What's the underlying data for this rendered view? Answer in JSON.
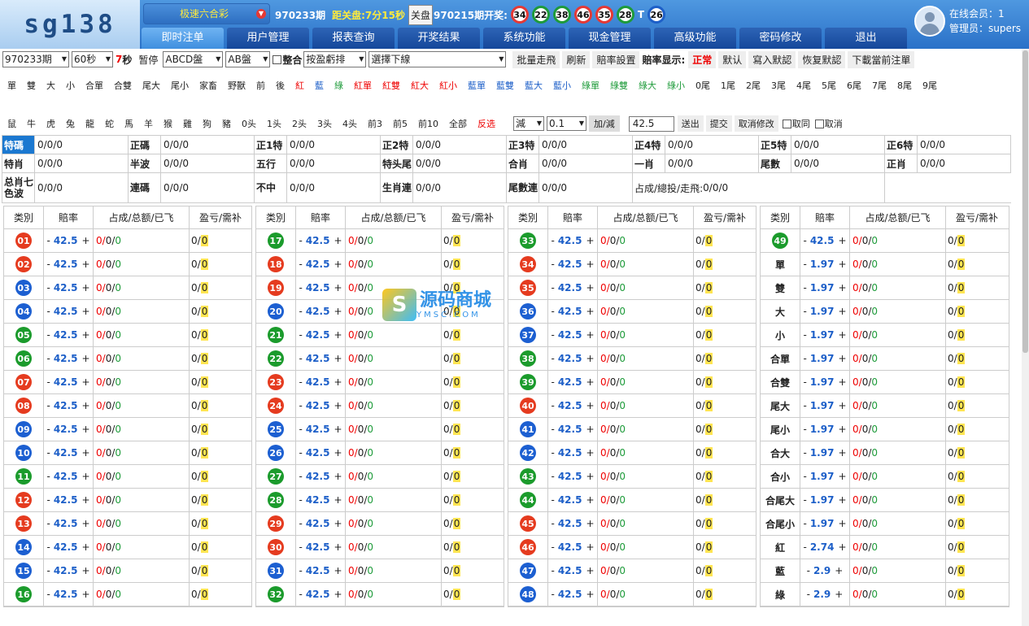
{
  "header": {
    "logo": "sg138",
    "lottery": "极速六合彩",
    "current_period": "970233期",
    "close_label": "距关盘:",
    "countdown": "7分15秒",
    "close_button": "关盘",
    "last_period": "970215期开奖:",
    "balls": [
      {
        "n": "34",
        "c": "red"
      },
      {
        "n": "22",
        "c": "green"
      },
      {
        "n": "38",
        "c": "green"
      },
      {
        "n": "46",
        "c": "red"
      },
      {
        "n": "35",
        "c": "red"
      },
      {
        "n": "28",
        "c": "green"
      },
      {
        "n": "26",
        "c": "blue"
      }
    ],
    "special_marker": "T",
    "online_label": "在线会员：",
    "online_count": "1",
    "admin_label": "管理员：",
    "admin_name": "supers"
  },
  "nav": [
    "即时注单",
    "用户管理",
    "报表查询",
    "开奖结果",
    "系统功能",
    "现金管理",
    "高级功能",
    "密码修改",
    "退出"
  ],
  "toolbar": {
    "period_select": "970233期",
    "interval_select": "60秒",
    "countdown": "7",
    "sec": "秒",
    "pause": "暂停",
    "pan_select": "ABCD盤",
    "ab_select": "AB盤",
    "merge": "整合",
    "sort_select": "按盈虧排",
    "line_select": "選擇下線",
    "batch": "批量走飛",
    "refresh": "刷新",
    "odds_set": "賠率設置",
    "odds_display_label": "賠率显示:",
    "odds_display_value": "正常",
    "default": "默认",
    "write_default": "寫入默認",
    "restore_default": "恢复默認",
    "download": "下載當前注單"
  },
  "filters1": [
    {
      "t": "單"
    },
    {
      "t": "雙"
    },
    {
      "t": "大"
    },
    {
      "t": "小"
    },
    {
      "t": "合單"
    },
    {
      "t": "合雙"
    },
    {
      "t": "尾大"
    },
    {
      "t": "尾小"
    },
    {
      "t": "家畜"
    },
    {
      "t": "野獸"
    },
    {
      "t": "前"
    },
    {
      "t": "後"
    },
    {
      "t": "紅",
      "c": "red"
    },
    {
      "t": "藍",
      "c": "blue"
    },
    {
      "t": "綠",
      "c": "green"
    },
    {
      "t": "紅單",
      "c": "red"
    },
    {
      "t": "紅雙",
      "c": "red"
    },
    {
      "t": "紅大",
      "c": "red"
    },
    {
      "t": "紅小",
      "c": "red"
    },
    {
      "t": "藍單",
      "c": "blue"
    },
    {
      "t": "藍雙",
      "c": "blue"
    },
    {
      "t": "藍大",
      "c": "blue"
    },
    {
      "t": "藍小",
      "c": "blue"
    },
    {
      "t": "綠單",
      "c": "green"
    },
    {
      "t": "綠雙",
      "c": "green"
    },
    {
      "t": "綠大",
      "c": "green"
    },
    {
      "t": "綠小",
      "c": "green"
    },
    {
      "t": "0尾"
    },
    {
      "t": "1尾"
    },
    {
      "t": "2尾"
    },
    {
      "t": "3尾"
    },
    {
      "t": "4尾"
    },
    {
      "t": "5尾"
    },
    {
      "t": "6尾"
    },
    {
      "t": "7尾"
    },
    {
      "t": "8尾"
    },
    {
      "t": "9尾"
    }
  ],
  "filters2": [
    {
      "t": "鼠"
    },
    {
      "t": "牛"
    },
    {
      "t": "虎"
    },
    {
      "t": "兔"
    },
    {
      "t": "龍"
    },
    {
      "t": "蛇"
    },
    {
      "t": "馬"
    },
    {
      "t": "羊"
    },
    {
      "t": "猴"
    },
    {
      "t": "雞"
    },
    {
      "t": "狗"
    },
    {
      "t": "豬"
    },
    {
      "t": "0头"
    },
    {
      "t": "1头"
    },
    {
      "t": "2头"
    },
    {
      "t": "3头"
    },
    {
      "t": "4头"
    },
    {
      "t": "前3"
    },
    {
      "t": "前5"
    },
    {
      "t": "前10"
    },
    {
      "t": "全部"
    },
    {
      "t": "反选",
      "c": "red"
    }
  ],
  "adjust": {
    "op_select": "減",
    "step_select": "0.1",
    "apply": "加/減",
    "odds_value": "42.5",
    "send": "送出",
    "submit": "提交",
    "cancel": "取消修改",
    "round": "取同",
    "cancel_fly": "取消"
  },
  "summary": {
    "row1": [
      {
        "l": "特碼",
        "hl": true
      },
      {
        "l": "正碼"
      },
      {
        "l": "正1特"
      },
      {
        "l": "正2特"
      },
      {
        "l": "正3特"
      },
      {
        "l": "正4特"
      },
      {
        "l": "正5特"
      },
      {
        "l": "正6特"
      }
    ],
    "row2": [
      {
        "l": "特肖"
      },
      {
        "l": "半波"
      },
      {
        "l": "五行"
      },
      {
        "l": "特头尾"
      },
      {
        "l": "合肖"
      },
      {
        "l": "一肖"
      },
      {
        "l": "尾數"
      },
      {
        "l": "正肖"
      }
    ],
    "row3": [
      {
        "l": "总肖七色波"
      },
      {
        "l": "連碼"
      },
      {
        "l": "不中"
      },
      {
        "l": "生肖連"
      },
      {
        "l": "尾數連"
      }
    ],
    "value": "0/0/0",
    "tail_label": "占成/總投/走飛:",
    "tail_value": "0/0/0"
  },
  "table_headers": [
    "类別",
    "賠率",
    "占成/总额/已飞",
    "盈亏/需补"
  ],
  "odds_cell": {
    "minus": "-",
    "plus": "+"
  },
  "amount": {
    "a": "0/",
    "b": "0/",
    "c": "0"
  },
  "pl": {
    "a": "0/",
    "b": "0"
  },
  "panels": [
    [
      {
        "n": "01",
        "c": "red",
        "o": "42.5"
      },
      {
        "n": "02",
        "c": "red",
        "o": "42.5"
      },
      {
        "n": "03",
        "c": "blue",
        "o": "42.5"
      },
      {
        "n": "04",
        "c": "blue",
        "o": "42.5"
      },
      {
        "n": "05",
        "c": "green",
        "o": "42.5"
      },
      {
        "n": "06",
        "c": "green",
        "o": "42.5"
      },
      {
        "n": "07",
        "c": "red",
        "o": "42.5"
      },
      {
        "n": "08",
        "c": "red",
        "o": "42.5"
      },
      {
        "n": "09",
        "c": "blue",
        "o": "42.5"
      },
      {
        "n": "10",
        "c": "blue",
        "o": "42.5"
      },
      {
        "n": "11",
        "c": "green",
        "o": "42.5"
      },
      {
        "n": "12",
        "c": "red",
        "o": "42.5"
      },
      {
        "n": "13",
        "c": "red",
        "o": "42.5"
      },
      {
        "n": "14",
        "c": "blue",
        "o": "42.5"
      },
      {
        "n": "15",
        "c": "blue",
        "o": "42.5"
      },
      {
        "n": "16",
        "c": "green",
        "o": "42.5"
      }
    ],
    [
      {
        "n": "17",
        "c": "green",
        "o": "42.5"
      },
      {
        "n": "18",
        "c": "red",
        "o": "42.5"
      },
      {
        "n": "19",
        "c": "red",
        "o": "42.5"
      },
      {
        "n": "20",
        "c": "blue",
        "o": "42.5"
      },
      {
        "n": "21",
        "c": "green",
        "o": "42.5"
      },
      {
        "n": "22",
        "c": "green",
        "o": "42.5"
      },
      {
        "n": "23",
        "c": "red",
        "o": "42.5"
      },
      {
        "n": "24",
        "c": "red",
        "o": "42.5"
      },
      {
        "n": "25",
        "c": "blue",
        "o": "42.5"
      },
      {
        "n": "26",
        "c": "blue",
        "o": "42.5"
      },
      {
        "n": "27",
        "c": "green",
        "o": "42.5"
      },
      {
        "n": "28",
        "c": "green",
        "o": "42.5"
      },
      {
        "n": "29",
        "c": "red",
        "o": "42.5"
      },
      {
        "n": "30",
        "c": "red",
        "o": "42.5"
      },
      {
        "n": "31",
        "c": "blue",
        "o": "42.5"
      },
      {
        "n": "32",
        "c": "green",
        "o": "42.5"
      }
    ],
    [
      {
        "n": "33",
        "c": "green",
        "o": "42.5"
      },
      {
        "n": "34",
        "c": "red",
        "o": "42.5"
      },
      {
        "n": "35",
        "c": "red",
        "o": "42.5"
      },
      {
        "n": "36",
        "c": "blue",
        "o": "42.5"
      },
      {
        "n": "37",
        "c": "blue",
        "o": "42.5"
      },
      {
        "n": "38",
        "c": "green",
        "o": "42.5"
      },
      {
        "n": "39",
        "c": "green",
        "o": "42.5"
      },
      {
        "n": "40",
        "c": "red",
        "o": "42.5"
      },
      {
        "n": "41",
        "c": "blue",
        "o": "42.5"
      },
      {
        "n": "42",
        "c": "blue",
        "o": "42.5"
      },
      {
        "n": "43",
        "c": "green",
        "o": "42.5"
      },
      {
        "n": "44",
        "c": "green",
        "o": "42.5"
      },
      {
        "n": "45",
        "c": "red",
        "o": "42.5"
      },
      {
        "n": "46",
        "c": "red",
        "o": "42.5"
      },
      {
        "n": "47",
        "c": "blue",
        "o": "42.5"
      },
      {
        "n": "48",
        "c": "blue",
        "o": "42.5"
      }
    ],
    [
      {
        "n": "49",
        "c": "green",
        "o": "42.5"
      },
      {
        "t": "單",
        "o": "1.97"
      },
      {
        "t": "雙",
        "o": "1.97"
      },
      {
        "t": "大",
        "o": "1.97"
      },
      {
        "t": "小",
        "o": "1.97"
      },
      {
        "t": "合單",
        "o": "1.97"
      },
      {
        "t": "合雙",
        "o": "1.97"
      },
      {
        "t": "尾大",
        "o": "1.97"
      },
      {
        "t": "尾小",
        "o": "1.97"
      },
      {
        "t": "合大",
        "o": "1.97"
      },
      {
        "t": "合小",
        "o": "1.97"
      },
      {
        "t": "合尾大",
        "o": "1.97"
      },
      {
        "t": "合尾小",
        "o": "1.97"
      },
      {
        "t": "紅",
        "o": "2.74"
      },
      {
        "t": "藍",
        "o": "2.9"
      },
      {
        "t": "綠",
        "o": "2.9"
      }
    ]
  ],
  "watermark": {
    "glyph": "S",
    "text": "源码商城",
    "sub": "YMSC.COM"
  }
}
